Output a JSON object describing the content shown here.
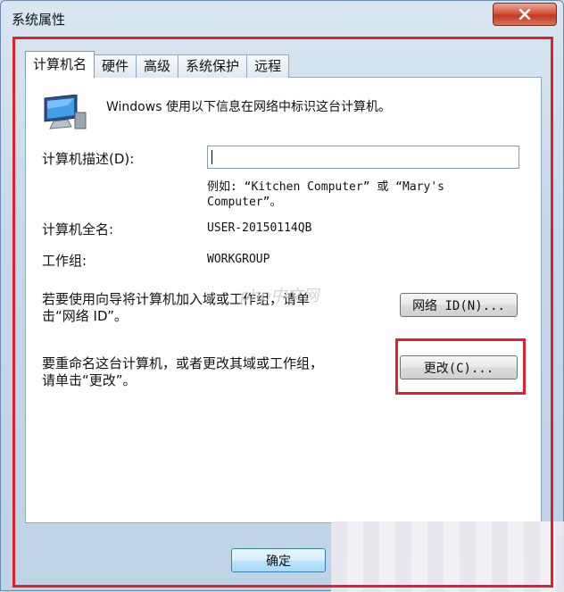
{
  "window": {
    "title": "系统属性"
  },
  "tabs": [
    {
      "label": "计算机名",
      "active": true
    },
    {
      "label": "硬件",
      "active": false
    },
    {
      "label": "高级",
      "active": false
    },
    {
      "label": "系统保护",
      "active": false
    },
    {
      "label": "远程",
      "active": false
    }
  ],
  "intro_text": "Windows 使用以下信息在网络中标识这台计算机。",
  "description": {
    "label": "计算机描述(D):",
    "value": "",
    "example_line1": "例如: “Kitchen Computer” 或 “Mary's",
    "example_line2": "Computer”。"
  },
  "full_name": {
    "label": "计算机全名:",
    "value": "USER-20150114QB"
  },
  "workgroup": {
    "label": "工作组:",
    "value": "WORKGROUP"
  },
  "join_domain": {
    "line1": "若要使用向导将计算机加入域或工作组，请单",
    "line2": "击“网络 ID”。",
    "button": "网络 ID(N)..."
  },
  "rename": {
    "line1": "要重命名这台计算机，或者更改其域或工作组，",
    "line2": "请单击“更改”。",
    "button": "更改(C)..."
  },
  "footer": {
    "ok_button": "确定"
  },
  "watermark": "php中文网",
  "colors": {
    "highlight": "#e0202a",
    "close": "#c13a22"
  }
}
